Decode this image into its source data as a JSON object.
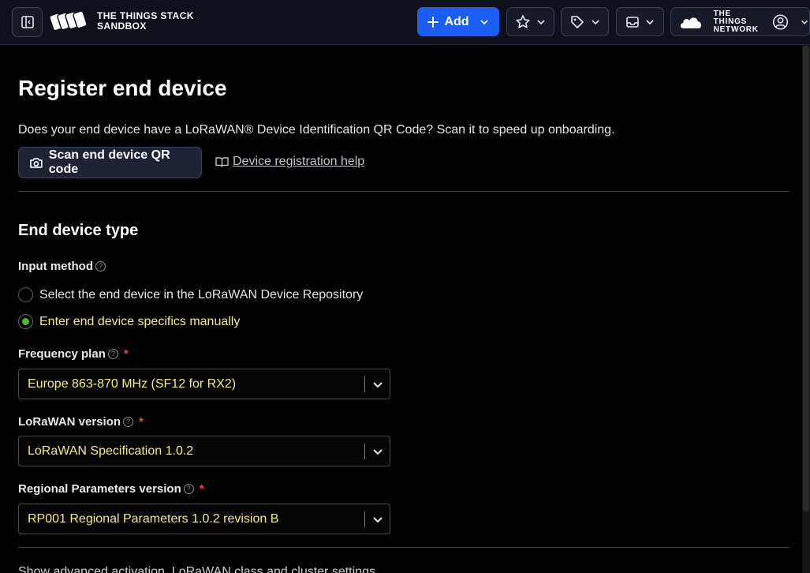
{
  "header": {
    "brand_line1": "THE THINGS STACK",
    "brand_line2": "SANDBOX",
    "add_label": "Add",
    "network_line1": "THE THINGS",
    "network_line2": "NETWORK",
    "accent_color": "#1a5ef5"
  },
  "main": {
    "title": "Register end device",
    "qr_question": "Does your end device have a LoRaWAN® Device Identification QR Code? Scan it to speed up onboarding.",
    "scan_button": "Scan end device QR code",
    "help_link": "Device registration help",
    "section_title": "End device type",
    "input_method": {
      "label": "Input method",
      "options": [
        {
          "label": "Select the end device in the LoRaWAN Device Repository",
          "selected": false
        },
        {
          "label": "Enter end device specifics manually",
          "selected": true
        }
      ]
    },
    "frequency_plan": {
      "label": "Frequency plan",
      "required": "*",
      "value": "Europe 863-870 MHz (SF12 for RX2)"
    },
    "lorawan_version": {
      "label": "LoRaWAN version",
      "required": "*",
      "value": "LoRaWAN Specification 1.0.2"
    },
    "regional_params": {
      "label": "Regional Parameters version",
      "required": "*",
      "value": "RP001 Regional Parameters 1.0.2 revision B"
    },
    "cut_off_text": "Show advanced activation, LoRaWAN class and cluster settings"
  }
}
